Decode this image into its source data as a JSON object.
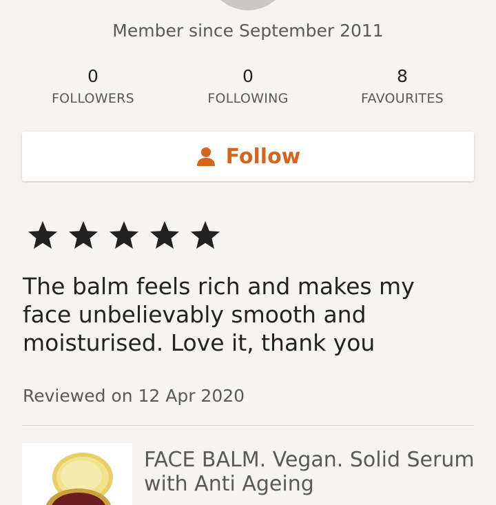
{
  "profile": {
    "member_since": "Member since September 2011"
  },
  "stats": [
    {
      "value": "0",
      "label": "FOLLOWERS"
    },
    {
      "value": "0",
      "label": "FOLLOWING"
    },
    {
      "value": "8",
      "label": "FAVOURITES"
    }
  ],
  "follow_button": {
    "label": "Follow",
    "icon": "person-icon",
    "color": "#d5641c"
  },
  "review": {
    "rating": 5,
    "rating_max": 5,
    "star_color": "#222222",
    "text": "The balm feels rich and makes my face unbelievably smooth and moisturised. Love it, thank you",
    "reviewed_on": "Reviewed on 12 Apr 2020"
  },
  "product": {
    "title": "FACE BALM. Vegan. Solid Serum with Anti Ageing"
  }
}
